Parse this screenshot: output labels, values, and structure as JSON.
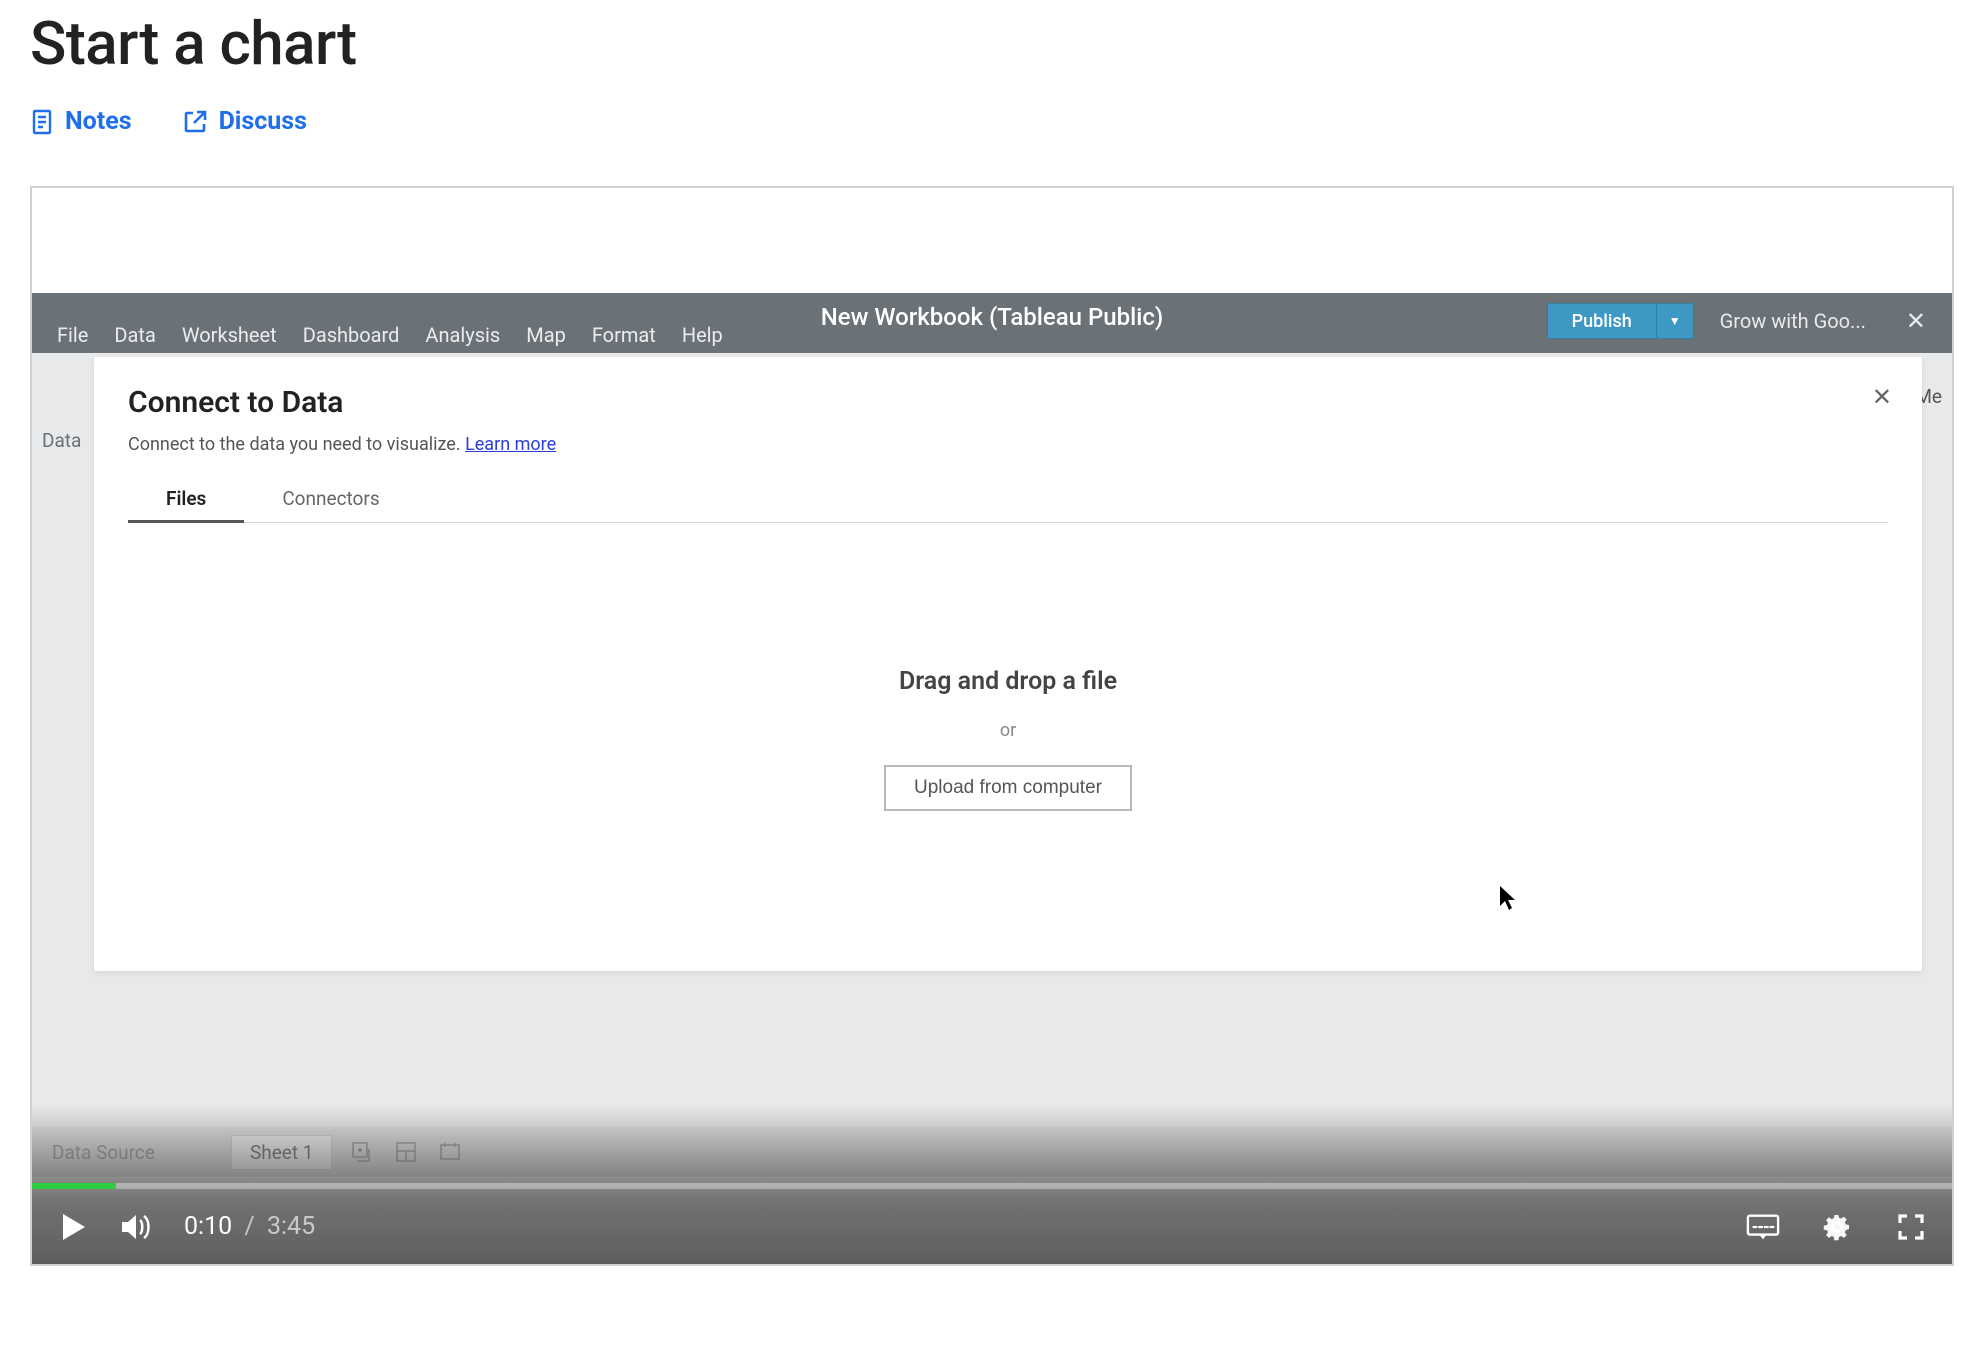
{
  "page": {
    "title": "Start a chart",
    "links": {
      "notes": "Notes",
      "discuss": "Discuss"
    }
  },
  "tableau": {
    "title": "New Workbook (Tableau Public)",
    "menus": [
      "File",
      "Data",
      "Worksheet",
      "Dashboard",
      "Analysis",
      "Map",
      "Format",
      "Help"
    ],
    "publish": "Publish",
    "grow": "Grow with Goo...",
    "side_label": "Data",
    "side_me": "Me",
    "sheets": {
      "data_source": "Data Source",
      "sheet1": "Sheet 1"
    }
  },
  "modal": {
    "title": "Connect to Data",
    "subtitle_pre": "Connect to the data you need to visualize. ",
    "learn_more": "Learn more",
    "tabs": {
      "files": "Files",
      "connectors": "Connectors"
    },
    "drag_title": "Drag and drop a file",
    "or": "or",
    "upload": "Upload from computer"
  },
  "video": {
    "current": "0:10",
    "separator": "/",
    "duration": "3:45"
  }
}
